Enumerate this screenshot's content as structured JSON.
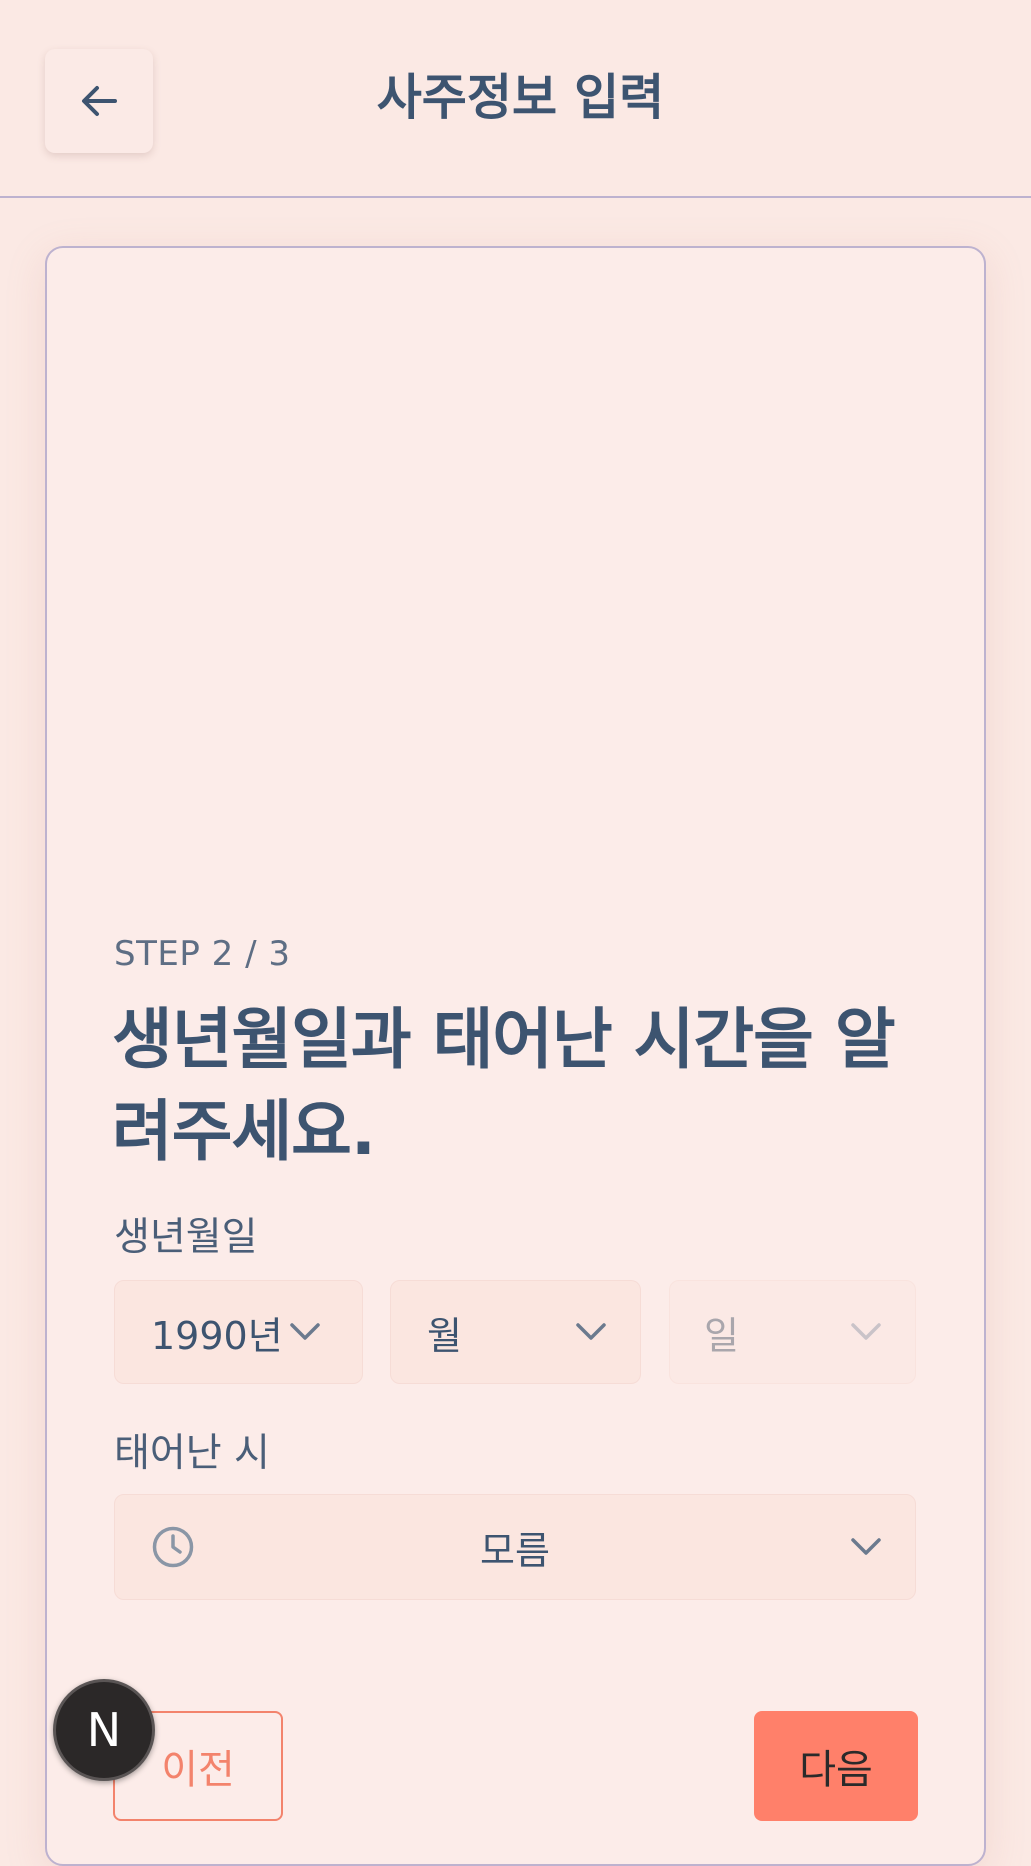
{
  "header": {
    "title": "사주정보 입력",
    "back_icon": "arrow-left-icon"
  },
  "form": {
    "step": "STEP 2 / 3",
    "heading": "생년월일과 태어난 시간을 알려주세요.",
    "dob_label": "생년월일",
    "year_value": "1990년",
    "month_placeholder": "월",
    "day_placeholder": "일",
    "time_label": "태어난 시",
    "time_value": "모름",
    "time_icon": "clock-icon"
  },
  "buttons": {
    "prev": "이전",
    "next": "다음"
  },
  "badge": {
    "letter": "N"
  },
  "colors": {
    "background": "#FBE9E4",
    "text": "#3D5470",
    "accent": "#FF806A",
    "border": "#BDB2CF"
  }
}
